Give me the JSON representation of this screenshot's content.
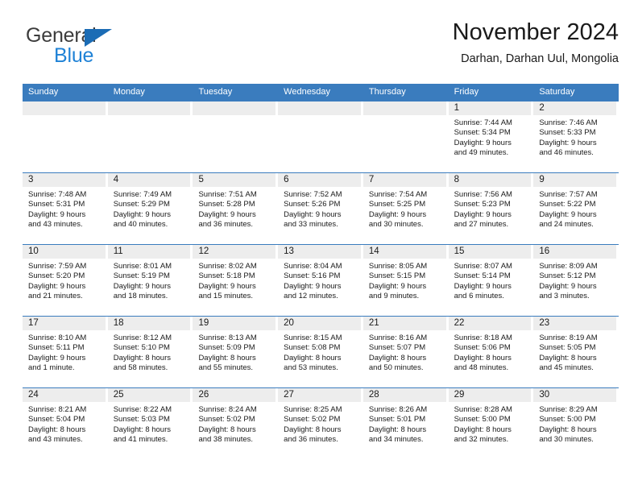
{
  "brand": {
    "name_top": "General",
    "name_bottom": "Blue",
    "triangle_icon": "triangle-icon",
    "color_dark": "#3c3c3c",
    "color_blue": "#1f82d6"
  },
  "header": {
    "title": "November 2024",
    "subtitle": "Darhan, Darhan Uul, Mongolia"
  },
  "theme": {
    "header_blue": "#3a7cbe",
    "day_band_gray": "#ededed",
    "text": "#1a1a1a"
  },
  "weekdays": [
    "Sunday",
    "Monday",
    "Tuesday",
    "Wednesday",
    "Thursday",
    "Friday",
    "Saturday"
  ],
  "labels": {
    "sunrise": "Sunrise:",
    "sunset": "Sunset:",
    "daylight": "Daylight:"
  },
  "weeks": [
    [
      {
        "day": "",
        "empty": true
      },
      {
        "day": "",
        "empty": true
      },
      {
        "day": "",
        "empty": true
      },
      {
        "day": "",
        "empty": true
      },
      {
        "day": "",
        "empty": true
      },
      {
        "day": "1",
        "sunrise": "Sunrise: 7:44 AM",
        "sunset": "Sunset: 5:34 PM",
        "daylight_1": "Daylight: 9 hours",
        "daylight_2": "and 49 minutes."
      },
      {
        "day": "2",
        "sunrise": "Sunrise: 7:46 AM",
        "sunset": "Sunset: 5:33 PM",
        "daylight_1": "Daylight: 9 hours",
        "daylight_2": "and 46 minutes."
      }
    ],
    [
      {
        "day": "3",
        "sunrise": "Sunrise: 7:48 AM",
        "sunset": "Sunset: 5:31 PM",
        "daylight_1": "Daylight: 9 hours",
        "daylight_2": "and 43 minutes."
      },
      {
        "day": "4",
        "sunrise": "Sunrise: 7:49 AM",
        "sunset": "Sunset: 5:29 PM",
        "daylight_1": "Daylight: 9 hours",
        "daylight_2": "and 40 minutes."
      },
      {
        "day": "5",
        "sunrise": "Sunrise: 7:51 AM",
        "sunset": "Sunset: 5:28 PM",
        "daylight_1": "Daylight: 9 hours",
        "daylight_2": "and 36 minutes."
      },
      {
        "day": "6",
        "sunrise": "Sunrise: 7:52 AM",
        "sunset": "Sunset: 5:26 PM",
        "daylight_1": "Daylight: 9 hours",
        "daylight_2": "and 33 minutes."
      },
      {
        "day": "7",
        "sunrise": "Sunrise: 7:54 AM",
        "sunset": "Sunset: 5:25 PM",
        "daylight_1": "Daylight: 9 hours",
        "daylight_2": "and 30 minutes."
      },
      {
        "day": "8",
        "sunrise": "Sunrise: 7:56 AM",
        "sunset": "Sunset: 5:23 PM",
        "daylight_1": "Daylight: 9 hours",
        "daylight_2": "and 27 minutes."
      },
      {
        "day": "9",
        "sunrise": "Sunrise: 7:57 AM",
        "sunset": "Sunset: 5:22 PM",
        "daylight_1": "Daylight: 9 hours",
        "daylight_2": "and 24 minutes."
      }
    ],
    [
      {
        "day": "10",
        "sunrise": "Sunrise: 7:59 AM",
        "sunset": "Sunset: 5:20 PM",
        "daylight_1": "Daylight: 9 hours",
        "daylight_2": "and 21 minutes."
      },
      {
        "day": "11",
        "sunrise": "Sunrise: 8:01 AM",
        "sunset": "Sunset: 5:19 PM",
        "daylight_1": "Daylight: 9 hours",
        "daylight_2": "and 18 minutes."
      },
      {
        "day": "12",
        "sunrise": "Sunrise: 8:02 AM",
        "sunset": "Sunset: 5:18 PM",
        "daylight_1": "Daylight: 9 hours",
        "daylight_2": "and 15 minutes."
      },
      {
        "day": "13",
        "sunrise": "Sunrise: 8:04 AM",
        "sunset": "Sunset: 5:16 PM",
        "daylight_1": "Daylight: 9 hours",
        "daylight_2": "and 12 minutes."
      },
      {
        "day": "14",
        "sunrise": "Sunrise: 8:05 AM",
        "sunset": "Sunset: 5:15 PM",
        "daylight_1": "Daylight: 9 hours",
        "daylight_2": "and 9 minutes."
      },
      {
        "day": "15",
        "sunrise": "Sunrise: 8:07 AM",
        "sunset": "Sunset: 5:14 PM",
        "daylight_1": "Daylight: 9 hours",
        "daylight_2": "and 6 minutes."
      },
      {
        "day": "16",
        "sunrise": "Sunrise: 8:09 AM",
        "sunset": "Sunset: 5:12 PM",
        "daylight_1": "Daylight: 9 hours",
        "daylight_2": "and 3 minutes."
      }
    ],
    [
      {
        "day": "17",
        "sunrise": "Sunrise: 8:10 AM",
        "sunset": "Sunset: 5:11 PM",
        "daylight_1": "Daylight: 9 hours",
        "daylight_2": "and 1 minute."
      },
      {
        "day": "18",
        "sunrise": "Sunrise: 8:12 AM",
        "sunset": "Sunset: 5:10 PM",
        "daylight_1": "Daylight: 8 hours",
        "daylight_2": "and 58 minutes."
      },
      {
        "day": "19",
        "sunrise": "Sunrise: 8:13 AM",
        "sunset": "Sunset: 5:09 PM",
        "daylight_1": "Daylight: 8 hours",
        "daylight_2": "and 55 minutes."
      },
      {
        "day": "20",
        "sunrise": "Sunrise: 8:15 AM",
        "sunset": "Sunset: 5:08 PM",
        "daylight_1": "Daylight: 8 hours",
        "daylight_2": "and 53 minutes."
      },
      {
        "day": "21",
        "sunrise": "Sunrise: 8:16 AM",
        "sunset": "Sunset: 5:07 PM",
        "daylight_1": "Daylight: 8 hours",
        "daylight_2": "and 50 minutes."
      },
      {
        "day": "22",
        "sunrise": "Sunrise: 8:18 AM",
        "sunset": "Sunset: 5:06 PM",
        "daylight_1": "Daylight: 8 hours",
        "daylight_2": "and 48 minutes."
      },
      {
        "day": "23",
        "sunrise": "Sunrise: 8:19 AM",
        "sunset": "Sunset: 5:05 PM",
        "daylight_1": "Daylight: 8 hours",
        "daylight_2": "and 45 minutes."
      }
    ],
    [
      {
        "day": "24",
        "sunrise": "Sunrise: 8:21 AM",
        "sunset": "Sunset: 5:04 PM",
        "daylight_1": "Daylight: 8 hours",
        "daylight_2": "and 43 minutes."
      },
      {
        "day": "25",
        "sunrise": "Sunrise: 8:22 AM",
        "sunset": "Sunset: 5:03 PM",
        "daylight_1": "Daylight: 8 hours",
        "daylight_2": "and 41 minutes."
      },
      {
        "day": "26",
        "sunrise": "Sunrise: 8:24 AM",
        "sunset": "Sunset: 5:02 PM",
        "daylight_1": "Daylight: 8 hours",
        "daylight_2": "and 38 minutes."
      },
      {
        "day": "27",
        "sunrise": "Sunrise: 8:25 AM",
        "sunset": "Sunset: 5:02 PM",
        "daylight_1": "Daylight: 8 hours",
        "daylight_2": "and 36 minutes."
      },
      {
        "day": "28",
        "sunrise": "Sunrise: 8:26 AM",
        "sunset": "Sunset: 5:01 PM",
        "daylight_1": "Daylight: 8 hours",
        "daylight_2": "and 34 minutes."
      },
      {
        "day": "29",
        "sunrise": "Sunrise: 8:28 AM",
        "sunset": "Sunset: 5:00 PM",
        "daylight_1": "Daylight: 8 hours",
        "daylight_2": "and 32 minutes."
      },
      {
        "day": "30",
        "sunrise": "Sunrise: 8:29 AM",
        "sunset": "Sunset: 5:00 PM",
        "daylight_1": "Daylight: 8 hours",
        "daylight_2": "and 30 minutes."
      }
    ]
  ]
}
